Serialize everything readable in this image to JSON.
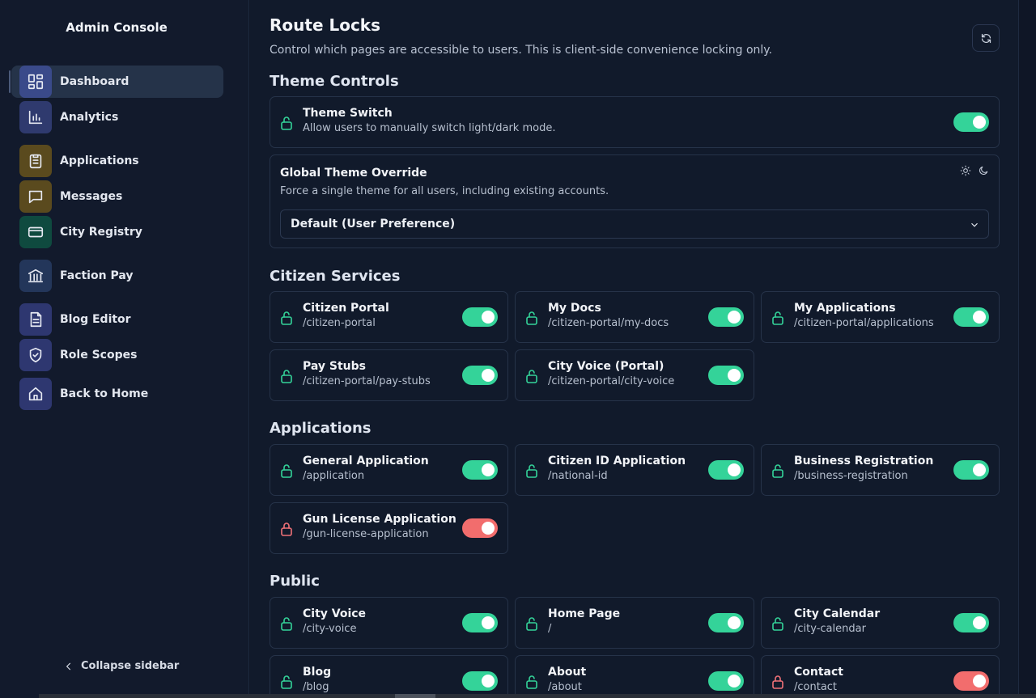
{
  "sidebar": {
    "brand": "Admin Console",
    "items": [
      {
        "label": "Dashboard",
        "icon": "dashboard-icon",
        "color": "#2f3f7a"
      },
      {
        "label": "Analytics",
        "icon": "bar-chart-icon",
        "color": "#2f3a6e"
      },
      {
        "label": "Applications",
        "icon": "clipboard-icon",
        "color": "#5a4a1e"
      },
      {
        "label": "Messages",
        "icon": "message-icon",
        "color": "#5a4a1e"
      },
      {
        "label": "City Registry",
        "icon": "card-icon",
        "color": "#0f4a3f"
      },
      {
        "label": "Faction Pay",
        "icon": "bank-icon",
        "color": "#23365a"
      },
      {
        "label": "Blog Editor",
        "icon": "document-icon",
        "color": "#2e3770"
      },
      {
        "label": "Role Scopes",
        "icon": "shield-check-icon",
        "color": "#2e3770"
      },
      {
        "label": "Back to Home",
        "icon": "home-icon",
        "color": "#2e3770"
      }
    ],
    "collapse_label": "Collapse sidebar"
  },
  "header": {
    "title": "Route Locks",
    "subtitle": "Control which pages are accessible to users. This is client-side convenience locking only."
  },
  "theme_controls": {
    "title": "Theme Controls",
    "theme_switch": {
      "title": "Theme Switch",
      "description": "Allow users to manually switch light/dark mode.",
      "enabled": true
    },
    "global_override": {
      "title": "Global Theme Override",
      "description": "Force a single theme for all users, including existing accounts.",
      "selected": "Default (User Preference)"
    }
  },
  "sections": {
    "citizen": {
      "title": "Citizen Services",
      "items": [
        {
          "title": "Citizen Portal",
          "path": "/citizen-portal",
          "unlocked": true
        },
        {
          "title": "My Docs",
          "path": "/citizen-portal/my-docs",
          "unlocked": true
        },
        {
          "title": "My Applications",
          "path": "/citizen-portal/applications",
          "unlocked": true
        },
        {
          "title": "Pay Stubs",
          "path": "/citizen-portal/pay-stubs",
          "unlocked": true
        },
        {
          "title": "City Voice (Portal)",
          "path": "/citizen-portal/city-voice",
          "unlocked": true
        }
      ]
    },
    "applications": {
      "title": "Applications",
      "items": [
        {
          "title": "General Application",
          "path": "/application",
          "unlocked": true
        },
        {
          "title": "Citizen ID Application",
          "path": "/national-id",
          "unlocked": true
        },
        {
          "title": "Business Registration",
          "path": "/business-registration",
          "unlocked": true
        },
        {
          "title": "Gun License Application",
          "path": "/gun-license-application",
          "unlocked": false
        }
      ]
    },
    "public": {
      "title": "Public",
      "items": [
        {
          "title": "City Voice",
          "path": "/city-voice",
          "unlocked": true
        },
        {
          "title": "Home Page",
          "path": "/",
          "unlocked": true
        },
        {
          "title": "City Calendar",
          "path": "/city-calendar",
          "unlocked": true
        },
        {
          "title": "Blog",
          "path": "/blog",
          "unlocked": true
        },
        {
          "title": "About",
          "path": "/about",
          "unlocked": true
        },
        {
          "title": "Contact",
          "path": "/contact",
          "unlocked": false
        }
      ]
    }
  }
}
